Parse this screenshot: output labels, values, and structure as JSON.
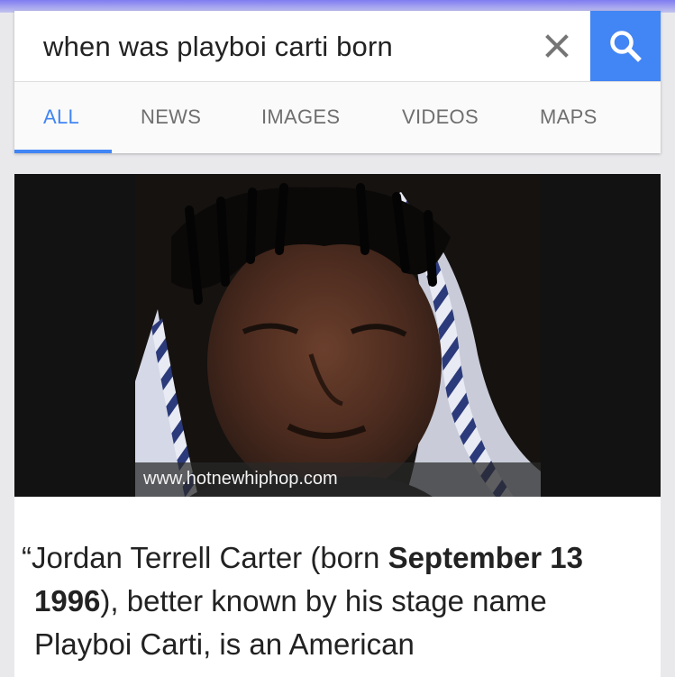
{
  "search": {
    "query": "when was playboi carti born"
  },
  "tabs": [
    {
      "label": "ALL",
      "active": true
    },
    {
      "label": "NEWS",
      "active": false
    },
    {
      "label": "IMAGES",
      "active": false
    },
    {
      "label": "VIDEOS",
      "active": false
    },
    {
      "label": "MAPS",
      "active": false
    }
  ],
  "image": {
    "source_caption": "www.hotnewhiphop.com"
  },
  "snippet": {
    "open_quote": "“",
    "part1": "Jordan Terrell Carter (born ",
    "bold_date": "September 13 1996",
    "part2": "), better known by his stage name Playboi Carti, is an American"
  },
  "colors": {
    "accent": "#4285f4",
    "tab_inactive": "#6f6f6f",
    "clear_icon": "#757575"
  },
  "icons": {
    "clear": "close-icon",
    "search": "search-icon"
  }
}
